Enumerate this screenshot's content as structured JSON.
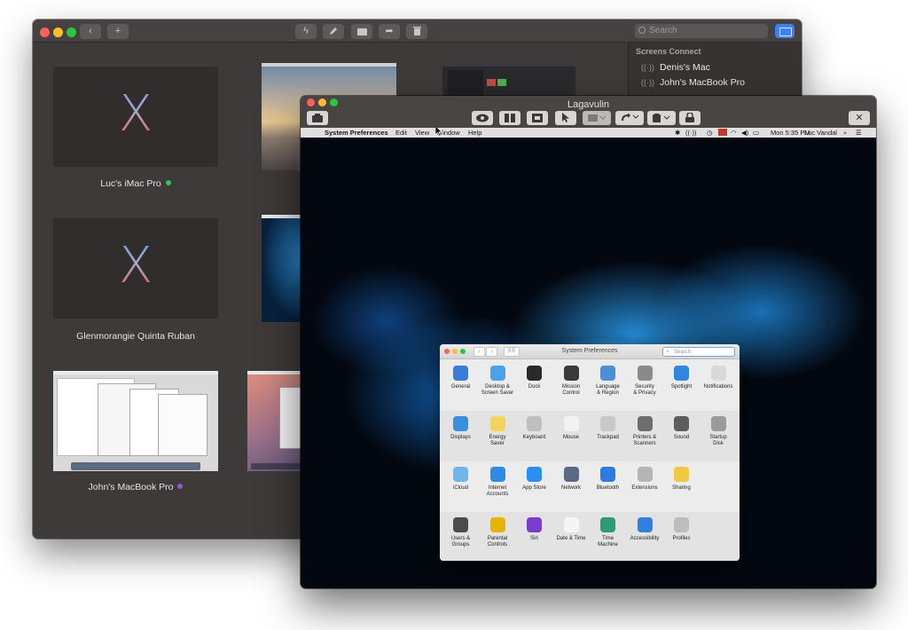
{
  "back_window": {
    "search_placeholder": "Search",
    "sidebar": {
      "header": "Screens Connect",
      "items": [
        "Denis's Mac",
        "John's MacBook Pro"
      ]
    },
    "tiles": [
      {
        "label": "Luc's iMac Pro",
        "status_color": "#34c748"
      },
      {
        "label": "Glenmorangie Quinta Ruban",
        "status_color": ""
      },
      {
        "label": "John's MacBook Pro",
        "status_color": "#8e5cc7"
      }
    ],
    "logo_glyph": "X"
  },
  "front_window": {
    "title": "Lagavulin",
    "close_glyph": "✕",
    "menubar": {
      "apple": "",
      "app": "System Preferences",
      "menus": [
        "Edit",
        "View",
        "Window",
        "Help"
      ],
      "clock": "Mon 5:35 PM",
      "user": "Luc Vandal"
    },
    "system_preferences": {
      "title": "System Preferences",
      "search_placeholder": "Search",
      "rows": [
        [
          {
            "label": "General",
            "icon": "general-icon",
            "color": "#3b7bd8"
          },
          {
            "label": "Desktop &\nScreen Saver",
            "icon": "desktop-icon",
            "color": "#4aa2e8"
          },
          {
            "label": "Dock",
            "icon": "dock-icon",
            "color": "#2a2a2a"
          },
          {
            "label": "Mission\nControl",
            "icon": "mission-control-icon",
            "color": "#3a3a3a"
          },
          {
            "label": "Language\n& Region",
            "icon": "language-icon",
            "color": "#4a90d9"
          },
          {
            "label": "Security\n& Privacy",
            "icon": "security-icon",
            "color": "#8a8a8a"
          },
          {
            "label": "Spotlight",
            "icon": "spotlight-icon",
            "color": "#2e86e0"
          },
          {
            "label": "Notifications",
            "icon": "notifications-icon",
            "color": "#d9d9d9"
          }
        ],
        [
          {
            "label": "Displays",
            "icon": "displays-icon",
            "color": "#3a8ee0"
          },
          {
            "label": "Energy\nSaver",
            "icon": "energy-saver-icon",
            "color": "#f3d35b"
          },
          {
            "label": "Keyboard",
            "icon": "keyboard-icon",
            "color": "#bfbfbf"
          },
          {
            "label": "Mouse",
            "icon": "mouse-icon",
            "color": "#f2f2f2"
          },
          {
            "label": "Trackpad",
            "icon": "trackpad-icon",
            "color": "#c8c8c8"
          },
          {
            "label": "Printers &\nScanners",
            "icon": "printer-icon",
            "color": "#6d6d6d"
          },
          {
            "label": "Sound",
            "icon": "sound-icon",
            "color": "#5d5d5d"
          },
          {
            "label": "Startup\nDisk",
            "icon": "startup-disk-icon",
            "color": "#9a9a9a"
          }
        ],
        [
          {
            "label": "iCloud",
            "icon": "icloud-icon",
            "color": "#6fb5f0"
          },
          {
            "label": "Internet\nAccounts",
            "icon": "internet-accounts-icon",
            "color": "#2f8ae5"
          },
          {
            "label": "App Store",
            "icon": "app-store-icon",
            "color": "#2a8ff0"
          },
          {
            "label": "Network",
            "icon": "network-icon",
            "color": "#5a6a86"
          },
          {
            "label": "Bluetooth",
            "icon": "bluetooth-icon",
            "color": "#2a7de0"
          },
          {
            "label": "Extensions",
            "icon": "extensions-icon",
            "color": "#b5b5b5"
          },
          {
            "label": "Sharing",
            "icon": "sharing-icon",
            "color": "#f1c83f"
          }
        ],
        [
          {
            "label": "Users &\nGroups",
            "icon": "users-icon",
            "color": "#4b4b4b"
          },
          {
            "label": "Parental\nControls",
            "icon": "parental-controls-icon",
            "color": "#e6b300"
          },
          {
            "label": "Siri",
            "icon": "siri-icon",
            "color": "#7a3bd0"
          },
          {
            "label": "Date & Time",
            "icon": "date-time-icon",
            "color": "#f5f5f5"
          },
          {
            "label": "Time\nMachine",
            "icon": "time-machine-icon",
            "color": "#2f9a7a"
          },
          {
            "label": "Accessibility",
            "icon": "accessibility-icon",
            "color": "#2f80e0"
          },
          {
            "label": "Profiles",
            "icon": "profiles-icon",
            "color": "#bdbdbd"
          }
        ]
      ]
    }
  }
}
